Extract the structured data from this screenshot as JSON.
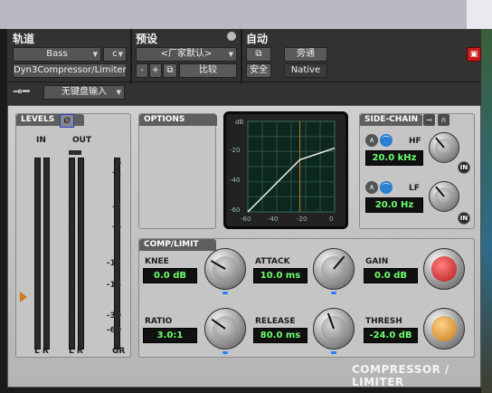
{
  "header": {
    "track_label": "轨道",
    "preset_label": "预设",
    "auto_label": "自动",
    "track_name": "Bass",
    "channel": "c",
    "insert_name": "Dyn3Compressor/Limiter",
    "preset_name": "<厂家默认>",
    "minus": "-",
    "plus": "+",
    "compare": "比较",
    "safe": "安全",
    "bypass": "旁通",
    "native": "Native",
    "key_input": "无键盘输入"
  },
  "levels": {
    "title": "LEVELS",
    "in_label": "IN",
    "out_label": "OUT",
    "ticks": [
      "0",
      "-1",
      "-3",
      "-6",
      "-12",
      "-18",
      "-30",
      "-60"
    ],
    "bottom_in": "L R",
    "bottom_out": "L R",
    "bottom_gr": "GR"
  },
  "options": {
    "title": "OPTIONS"
  },
  "graph": {
    "y_ticks": [
      "dB",
      "-20",
      "-40",
      "-60"
    ],
    "x_ticks": [
      "-60",
      "-40",
      "-20",
      "0"
    ]
  },
  "sidechain": {
    "title": "SIDE-CHAIN",
    "hf_label": "HF",
    "hf_value": "20.0 kHz",
    "lf_label": "LF",
    "lf_value": "20.0 Hz",
    "in_label": "IN"
  },
  "comp": {
    "title": "COMP/LIMIT",
    "knee_label": "KNEE",
    "knee_value": "0.0 dB",
    "attack_label": "ATTACK",
    "attack_value": "10.0 ms",
    "gain_label": "GAIN",
    "gain_value": "0.0 dB",
    "ratio_label": "RATIO",
    "ratio_value": "3.0:1",
    "release_label": "RELEASE",
    "release_value": "80.0 ms",
    "thresh_label": "THRESH",
    "thresh_value": "-24.0 dB"
  },
  "brand": "COMPRESSOR / LIMITER",
  "colors": {
    "accent_red": "#c41c1c",
    "value_green": "#6cff6c",
    "threshold_orange": "#e08a20"
  }
}
